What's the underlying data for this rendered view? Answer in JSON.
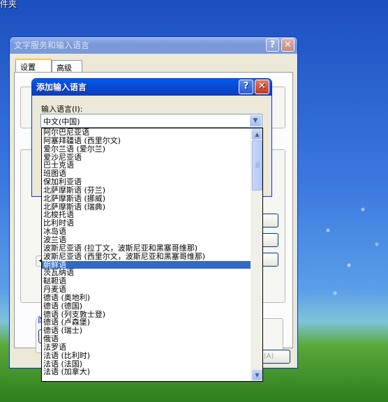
{
  "desktop": {
    "label": "件夹"
  },
  "back_window": {
    "title": "文字服务和输入语言",
    "tabs": [
      "设置",
      "高级"
    ],
    "group_label_partial": "首",
    "partial_button": "用(A)"
  },
  "front_window": {
    "title": "添加输入语言",
    "field_label": "输入语言(I):",
    "combo_value": "中文(中国)"
  },
  "dropdown": {
    "selected_index": 17,
    "items": [
      "阿尔巴尼亚语",
      "阿塞拜疆语 (西里尔文)",
      "爱尔兰语 (爱尔兰)",
      "爱沙尼亚语",
      "巴士克语",
      "班图语",
      "保加利亚语",
      "北萨摩斯语 (芬兰)",
      "北萨摩斯语 (挪威)",
      "北萨摩斯语 (瑞典)",
      "北梭托语",
      "比利时语",
      "冰岛语",
      "波兰语",
      "波斯尼亚语 (拉丁文，波斯尼亚和黑塞哥维那)",
      "波斯尼亚语 (西里尔文，波斯尼亚和黑塞哥维那)",
      "朝鲜语",
      "茨瓦纳语",
      "鞑靼语",
      "丹麦语",
      "德语 (奥地利)",
      "德语 (德国)",
      "德语 (列支敦士登)",
      "德语 (卢森堡)",
      "德语 (瑞士)",
      "俄语",
      "法罗语",
      "法语 (比利时)",
      "法语 (法国)",
      "法语 (加拿大)"
    ]
  }
}
